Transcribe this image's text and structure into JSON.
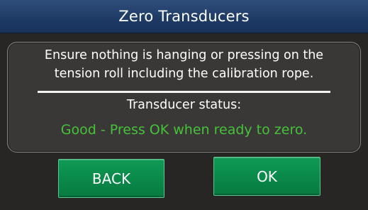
{
  "dialog": {
    "title": "Zero Transducers",
    "message_line1": "Ensure nothing is hanging or pressing on the",
    "message_line2": "tension roll including the calibration rope.",
    "status_label": "Transducer status:",
    "status_value": "Good - Press OK when ready to zero.",
    "status_color": "#45c23a"
  },
  "buttons": {
    "back_label": "BACK",
    "ok_label": "OK",
    "color": "#0a8a4a"
  },
  "theme": {
    "title_bar_color": "#1f3c66",
    "background_color": "#272625",
    "panel_color": "#3a3836"
  }
}
